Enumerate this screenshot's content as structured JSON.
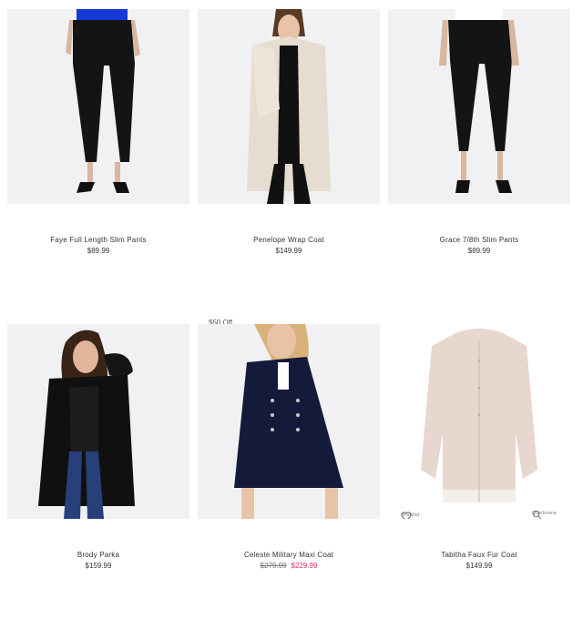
{
  "products": [
    {
      "name": "Faye Full Length Slim Pants",
      "price": "$89.99"
    },
    {
      "name": "Penelope Wrap Coat",
      "price": "$149.99"
    },
    {
      "name": "Grace 7/8th Slim Pants",
      "price": "$89.99"
    },
    {
      "name": "Brody Parka",
      "price": "$159.99"
    },
    {
      "name": "Celeste Military Maxi Coat",
      "was_price": "$279.99",
      "price": "$229.99",
      "badge": "$50 Off"
    },
    {
      "name": "Tabitha Faux Fur Coat",
      "price": "$149.99",
      "actions": {
        "wishlist": "Wishlist",
        "quickview": "Quickview"
      }
    }
  ],
  "colors": {
    "sale_price": "#d6336c",
    "image_bg": "#f1f1f3",
    "text": "#333333"
  }
}
